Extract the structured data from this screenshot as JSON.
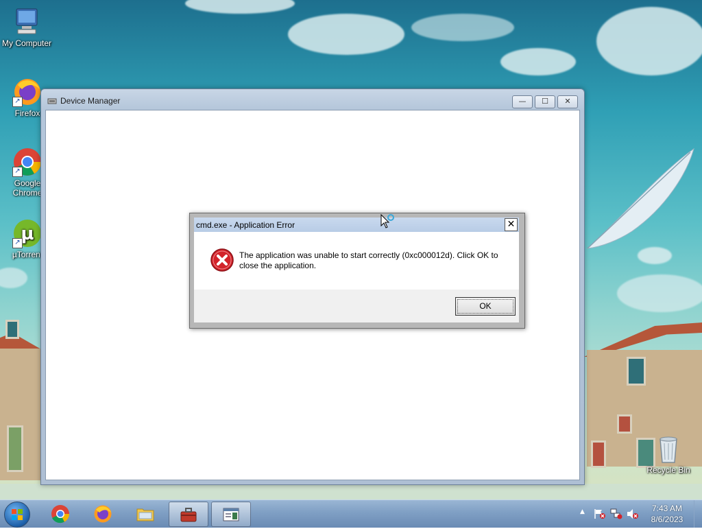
{
  "desktop": {
    "icons": [
      {
        "label": "My Computer",
        "icon": "computer-icon"
      },
      {
        "label": "Firefox",
        "icon": "firefox-icon"
      },
      {
        "label": "Google Chrome",
        "icon": "chrome-icon"
      },
      {
        "label": "µTorrent",
        "icon": "utorrent-icon"
      },
      {
        "label": "Recycle Bin",
        "icon": "recycle-bin-icon"
      }
    ]
  },
  "device_manager": {
    "title": "Device Manager",
    "buttons": {
      "minimize": "—",
      "maximize": "☐",
      "close": "✕"
    }
  },
  "error_dialog": {
    "title": "cmd.exe - Application Error",
    "close_label": "✕",
    "message": "The application was unable to start correctly (0xc000012d). Click OK to close the application.",
    "ok_label": "OK",
    "icon": "error-icon"
  },
  "taskbar": {
    "start_icon": "windows-start-icon",
    "pinned": [
      {
        "name": "chrome",
        "icon": "chrome-icon"
      },
      {
        "name": "firefox",
        "icon": "firefox-icon"
      },
      {
        "name": "file-explorer",
        "icon": "folder-icon"
      },
      {
        "name": "toolbox",
        "icon": "toolbox-icon"
      },
      {
        "name": "device-manager",
        "icon": "window-icon"
      }
    ],
    "tray": {
      "overflow_label": "▲",
      "time": "7:43 AM",
      "date": "8/6/2023"
    }
  },
  "colors": {
    "dialog_titlebar": "#c9d9ee",
    "error_red": "#d2232a",
    "taskbar": "#7f9fc4"
  }
}
